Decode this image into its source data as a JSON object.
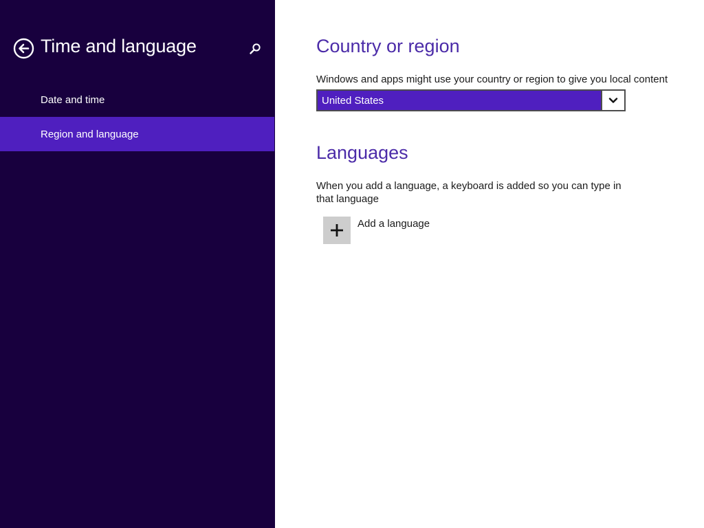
{
  "colors": {
    "left_pane_bg": "#18003e",
    "selected_item_bg": "#4f1fbf",
    "heading_accent": "#4b2ba8",
    "add_tile_bg": "#cdcdcd"
  },
  "left_pane": {
    "title": "Time and language",
    "back_icon": "back-arrow-circle-icon",
    "search_icon": "search-icon",
    "nav_items": [
      {
        "label": "Date and time",
        "selected": false
      },
      {
        "label": "Region and language",
        "selected": true
      }
    ]
  },
  "country_section": {
    "heading": "Country or region",
    "description": "Windows and apps might use your country or region to give you local content",
    "selected_country": "United States",
    "dropdown_icon": "chevron-down-icon"
  },
  "languages_section": {
    "heading": "Languages",
    "description": "When you add a language, a keyboard is added so you can type in that language",
    "add_label": "Add a language",
    "add_icon": "plus-icon"
  }
}
